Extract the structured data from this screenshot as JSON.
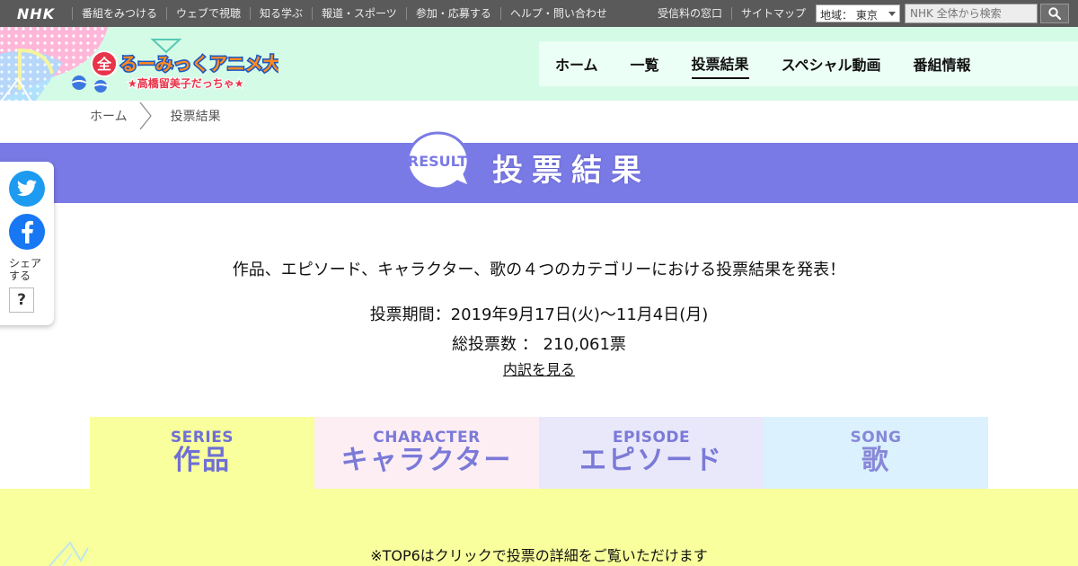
{
  "topbar": {
    "logo": "NHK",
    "nav": [
      "番組をみつける",
      "ウェブで視聴",
      "知る学ぶ",
      "報道・スポーツ",
      "参加・応募する",
      "ヘルプ・問い合わせ"
    ],
    "right_links": [
      "受信料の窓口",
      "サイトマップ"
    ],
    "region_label": "地域： 東京",
    "search_placeholder": "NHK 全体から検索"
  },
  "header": {
    "logo_title": "るーみっくアニメ大投票",
    "logo_badge": "全",
    "logo_subtitle": "★高橋留美子だっちゃ★",
    "nav": [
      {
        "label": "ホーム",
        "active": false
      },
      {
        "label": "一覧",
        "active": false
      },
      {
        "label": "投票結果",
        "active": true
      },
      {
        "label": "スペシャル動画",
        "active": false
      },
      {
        "label": "番組情報",
        "active": false
      }
    ]
  },
  "breadcrumb": {
    "home": "ホーム",
    "current": "投票結果"
  },
  "banner": {
    "badge": "RESULT",
    "title": "投票結果"
  },
  "share": {
    "label": "シェアする",
    "help": "?"
  },
  "content": {
    "intro": "作品、エピソード、キャラクター、歌の４つのカテゴリーにおける投票結果を発表！",
    "period": "投票期間：2019年9月17日(火)～11月4日(月)",
    "total": "総投票数 ： 210,061票",
    "breakdown_link": "内訳を見る",
    "note": "※TOP6はクリックで投票の詳細をご覧いただけます"
  },
  "tabs": [
    {
      "en": "SERIES",
      "jp": "作品"
    },
    {
      "en": "CHARACTER",
      "jp": "キャラクター"
    },
    {
      "en": "EPISODE",
      "jp": "エピソード"
    },
    {
      "en": "SONG",
      "jp": "歌"
    }
  ],
  "colors": {
    "topbar": "#5a5a5a",
    "header_bg": "#d4fbe6",
    "banner": "#7a7ae6",
    "series_tab": "#f8ff9c",
    "character_tab": "#fdeef4",
    "episode_tab": "#e9e8fb",
    "song_tab": "#dbf1fd"
  }
}
